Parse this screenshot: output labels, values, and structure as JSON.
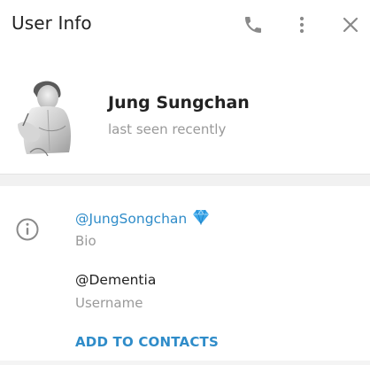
{
  "header": {
    "title": "User Info",
    "call_icon": "phone-icon",
    "more_icon": "more-vertical-icon",
    "close_icon": "close-icon"
  },
  "profile": {
    "name": "Jung Sungchan",
    "status": "last seen recently",
    "avatar_icon": "avatar-photo"
  },
  "info": {
    "icon": "info-icon",
    "bio_value": "@JungSongchan",
    "bio_emoji": "gem-icon",
    "bio_label": "Bio",
    "username_value": "@Dementia",
    "username_label": "Username",
    "add_contacts": "ADD TO CONTACTS"
  },
  "colors": {
    "link": "#2f8cc9",
    "muted": "#999999",
    "text": "#222222",
    "icon": "#8a8a8a"
  }
}
